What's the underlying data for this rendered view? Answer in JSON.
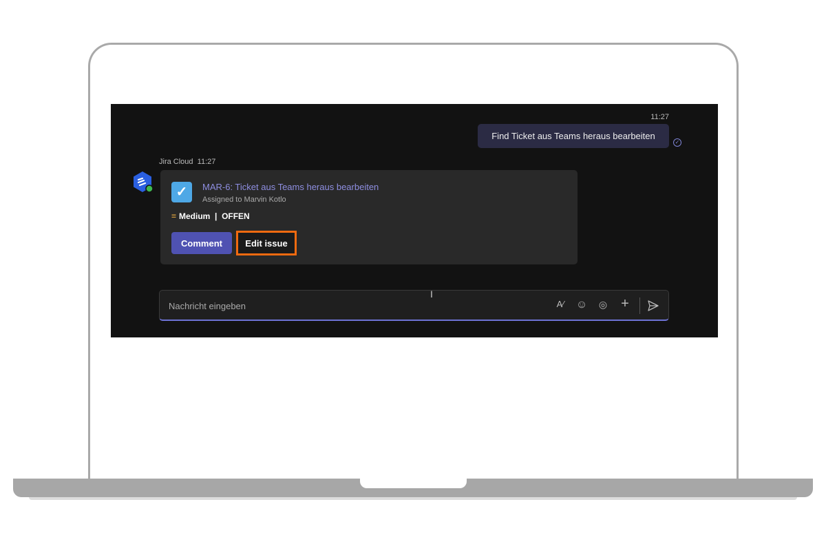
{
  "chat": {
    "outgoing": {
      "time": "11:27",
      "text": "Find Ticket aus Teams heraus bearbeiten"
    },
    "incoming": {
      "sender": "Jira Cloud",
      "time": "11:27",
      "card": {
        "title": "MAR-6: Ticket aus Teams heraus bearbeiten",
        "assigned": "Assigned to Marvin Kotlo",
        "priority": "Medium",
        "separator": "|",
        "status": "OFFEN",
        "comment_label": "Comment",
        "edit_label": "Edit issue"
      }
    }
  },
  "compose": {
    "placeholder": "Nachricht eingeben"
  },
  "colors": {
    "accent": "#4f52b2",
    "highlight": "#f26a10",
    "link": "#8e8ee0"
  }
}
